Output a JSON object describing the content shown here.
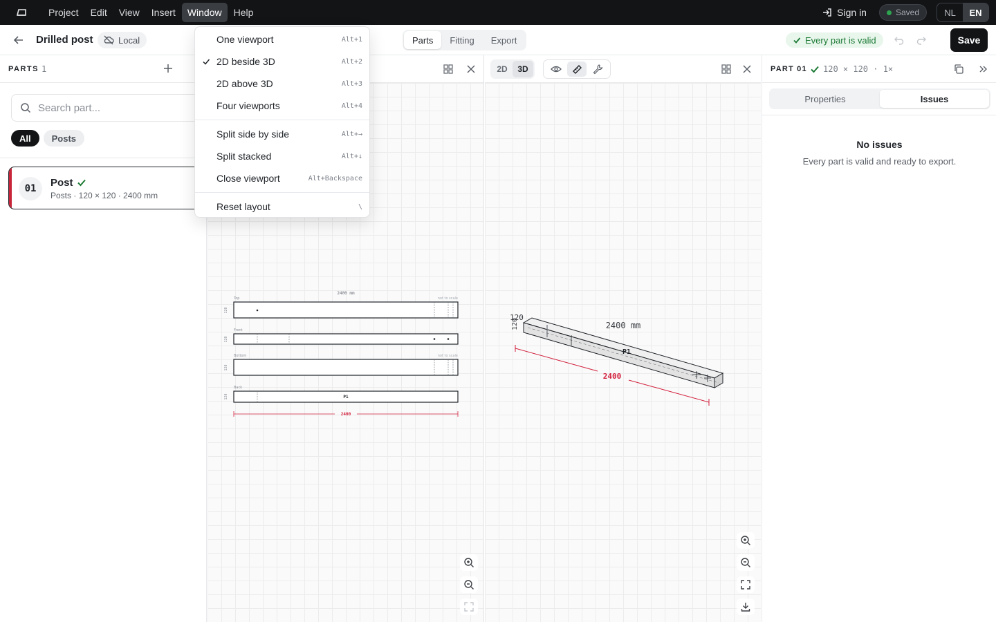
{
  "menubar": {
    "items": [
      "Project",
      "Edit",
      "View",
      "Insert",
      "Window",
      "Help"
    ],
    "active_index": 4,
    "sign_in": "Sign in",
    "saved": "Saved",
    "lang": [
      "NL",
      "EN"
    ],
    "lang_active": "EN"
  },
  "titlebar": {
    "title": "Drilled post",
    "storage": "Local",
    "tabs": [
      "Parts",
      "Fitting",
      "Export"
    ],
    "active_tab": "Parts",
    "valid": "Every part is valid",
    "save": "Save"
  },
  "window_menu": {
    "groups": [
      [
        {
          "label": "One viewport",
          "shortcut": "Alt+1",
          "checked": false
        },
        {
          "label": "2D beside 3D",
          "shortcut": "Alt+2",
          "checked": true
        },
        {
          "label": "2D above 3D",
          "shortcut": "Alt+3",
          "checked": false
        },
        {
          "label": "Four viewports",
          "shortcut": "Alt+4",
          "checked": false
        }
      ],
      [
        {
          "label": "Split side by side",
          "shortcut": "Alt+→",
          "checked": false
        },
        {
          "label": "Split stacked",
          "shortcut": "Alt+↓",
          "checked": false
        },
        {
          "label": "Close viewport",
          "shortcut": "Alt+Backspace",
          "checked": false
        }
      ],
      [
        {
          "label": "Reset layout",
          "shortcut": "\\",
          "checked": false
        }
      ]
    ]
  },
  "sidebar": {
    "header": "PARTS",
    "count": "1",
    "search_placeholder": "Search part...",
    "filters": [
      "All",
      "Posts"
    ],
    "active_filter": "All",
    "parts": [
      {
        "number": "01",
        "name": "Post",
        "meta": "Posts · 120 × 120 · 2400 mm",
        "color": "#c8243a"
      }
    ]
  },
  "viewport_3d": {
    "modes": [
      "2D",
      "3D"
    ],
    "active_mode": "3D"
  },
  "drawing_2d": {
    "length_label": "2400 mm",
    "views": [
      {
        "name": "Top",
        "note": "not to scale",
        "size": "120"
      },
      {
        "name": "Front",
        "note": "",
        "size": "120"
      },
      {
        "name": "Bottom",
        "note": "not to scale",
        "size": "120"
      },
      {
        "name": "Back",
        "note": "",
        "size": "120"
      }
    ],
    "part_label": "P1",
    "dimension": "2400"
  },
  "drawing_3d": {
    "length_label": "2400 mm",
    "section_size": "120",
    "part_label": "P1",
    "dimension": "2400"
  },
  "right_panel": {
    "header": "PART 01",
    "dims": "120 × 120 · 1×",
    "tabs": [
      "Properties",
      "Issues"
    ],
    "active_tab": "Issues",
    "empty_title": "No issues",
    "empty_text": "Every part is valid and ready to export."
  },
  "colors": {
    "accent_dark": "#121416",
    "valid_green": "#1d7a35",
    "dimension_red": "#d21f3c"
  }
}
